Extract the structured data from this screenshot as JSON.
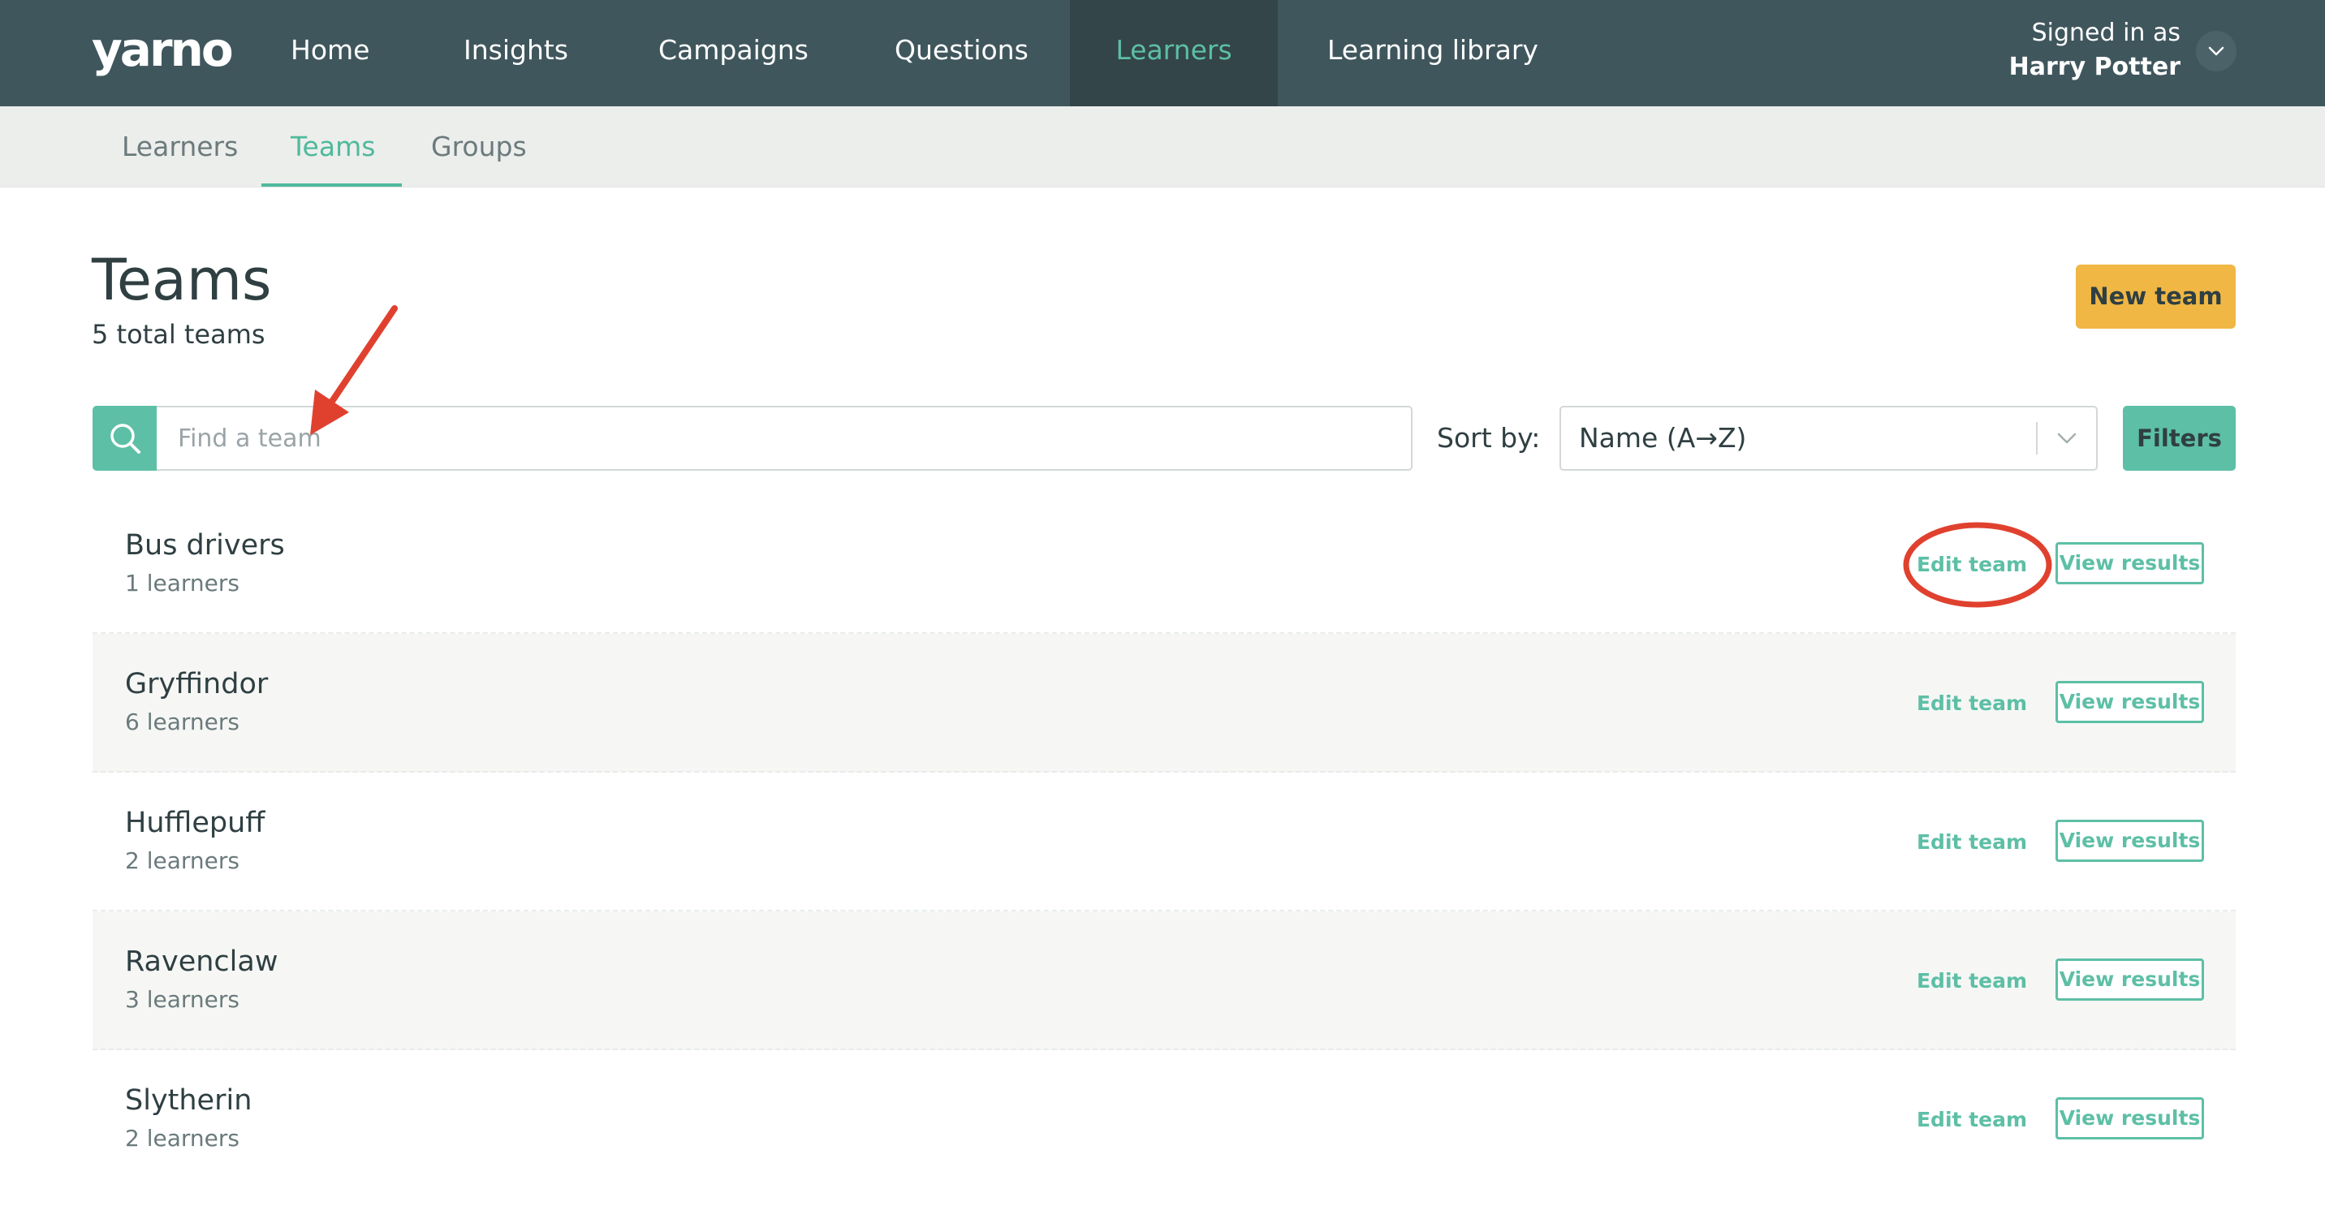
{
  "brand": {
    "logo_text": "yarno"
  },
  "nav": {
    "items": [
      {
        "label": "Home"
      },
      {
        "label": "Insights"
      },
      {
        "label": "Campaigns"
      },
      {
        "label": "Questions"
      },
      {
        "label": "Learners",
        "active": true
      },
      {
        "label": "Learning library"
      }
    ]
  },
  "user": {
    "signed_in_label": "Signed in as",
    "name": "Harry Potter"
  },
  "subnav": {
    "items": [
      {
        "label": "Learners"
      },
      {
        "label": "Teams",
        "active": true
      },
      {
        "label": "Groups"
      }
    ]
  },
  "page": {
    "title": "Teams",
    "count": "5 total teams",
    "new_team_label": "New team"
  },
  "search": {
    "placeholder": "Find a team",
    "value": ""
  },
  "sort": {
    "label": "Sort by:",
    "value": "Name (A→Z)"
  },
  "filters_label": "Filters",
  "teams": [
    {
      "name": "Bus drivers",
      "count": "1 learners",
      "edit_label": "Edit team",
      "view_label": "View results"
    },
    {
      "name": "Gryffindor",
      "count": "6 learners",
      "edit_label": "Edit team",
      "view_label": "View results"
    },
    {
      "name": "Hufflepuff",
      "count": "2 learners",
      "edit_label": "Edit team",
      "view_label": "View results"
    },
    {
      "name": "Ravenclaw",
      "count": "3 learners",
      "edit_label": "Edit team",
      "view_label": "View results"
    },
    {
      "name": "Slytherin",
      "count": "2 learners",
      "edit_label": "Edit team",
      "view_label": "View results"
    }
  ],
  "colors": {
    "nav_bg": "#3f565c",
    "accent_teal": "#5dbfa6",
    "accent_yellow": "#f0b744",
    "annotation_red": "#e0412f"
  },
  "icons": {
    "search": "search-icon",
    "user_menu": "chevron-down-icon",
    "sort": "chevron-down-icon"
  }
}
